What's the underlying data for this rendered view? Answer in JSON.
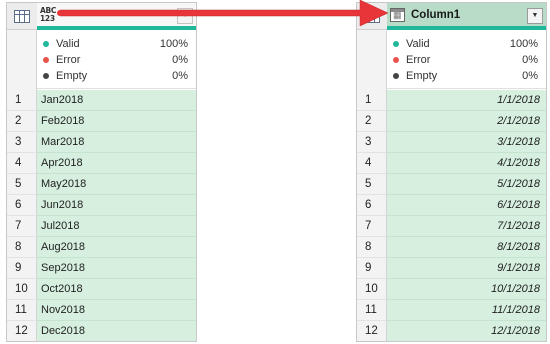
{
  "left_column": {
    "type_label_top": "ABC",
    "type_label_bottom": "123",
    "stats": [
      {
        "label": "Valid",
        "value": "100%",
        "color": "#1fb89a"
      },
      {
        "label": "Error",
        "value": "0%",
        "color": "#e8534a"
      },
      {
        "label": "Empty",
        "value": "0%",
        "color": "#444444"
      }
    ],
    "rows": [
      {
        "num": "1",
        "value": "Jan2018"
      },
      {
        "num": "2",
        "value": "Feb2018"
      },
      {
        "num": "3",
        "value": "Mar2018"
      },
      {
        "num": "4",
        "value": "Apr2018"
      },
      {
        "num": "5",
        "value": "May2018"
      },
      {
        "num": "6",
        "value": "Jun2018"
      },
      {
        "num": "7",
        "value": "Jul2018"
      },
      {
        "num": "8",
        "value": "Aug2018"
      },
      {
        "num": "9",
        "value": "Sep2018"
      },
      {
        "num": "10",
        "value": "Oct2018"
      },
      {
        "num": "11",
        "value": "Nov2018"
      },
      {
        "num": "12",
        "value": "Dec2018"
      }
    ]
  },
  "right_column": {
    "name": "Column1",
    "stats": [
      {
        "label": "Valid",
        "value": "100%",
        "color": "#1fb89a"
      },
      {
        "label": "Error",
        "value": "0%",
        "color": "#e8534a"
      },
      {
        "label": "Empty",
        "value": "0%",
        "color": "#444444"
      }
    ],
    "rows": [
      {
        "num": "1",
        "value": "1/1/2018"
      },
      {
        "num": "2",
        "value": "2/1/2018"
      },
      {
        "num": "3",
        "value": "3/1/2018"
      },
      {
        "num": "4",
        "value": "4/1/2018"
      },
      {
        "num": "5",
        "value": "5/1/2018"
      },
      {
        "num": "6",
        "value": "6/1/2018"
      },
      {
        "num": "7",
        "value": "7/1/2018"
      },
      {
        "num": "8",
        "value": "8/1/2018"
      },
      {
        "num": "9",
        "value": "9/1/2018"
      },
      {
        "num": "10",
        "value": "10/1/2018"
      },
      {
        "num": "11",
        "value": "11/1/2018"
      },
      {
        "num": "12",
        "value": "12/1/2018"
      }
    ]
  },
  "icons": {
    "table_corner": "table-icon",
    "left_type": "any-type-icon",
    "right_type": "date-type-icon",
    "filter": "dropdown-arrow-icon"
  },
  "colors": {
    "accent": "#1fb89a",
    "cell_bg": "#d6efdf",
    "selected_header": "#b9dcc8",
    "arrow": "#e8353a"
  }
}
